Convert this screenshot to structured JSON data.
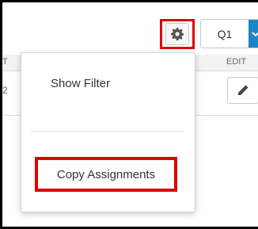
{
  "toolbar": {
    "settings_icon": "gear-icon",
    "quarter_select": {
      "value": "Q1",
      "caret_icon": "chevron-down-icon"
    }
  },
  "table": {
    "header_left_fragment": "T",
    "header_edit": "EDIT",
    "row_left_fragment": "2",
    "row_edit_icon": "pencil-icon"
  },
  "menu": {
    "show_filter": "Show Filter",
    "copy_assignments": "Copy Assignments"
  },
  "colors": {
    "highlight": "#e00000",
    "accent": "#1a86c8"
  }
}
